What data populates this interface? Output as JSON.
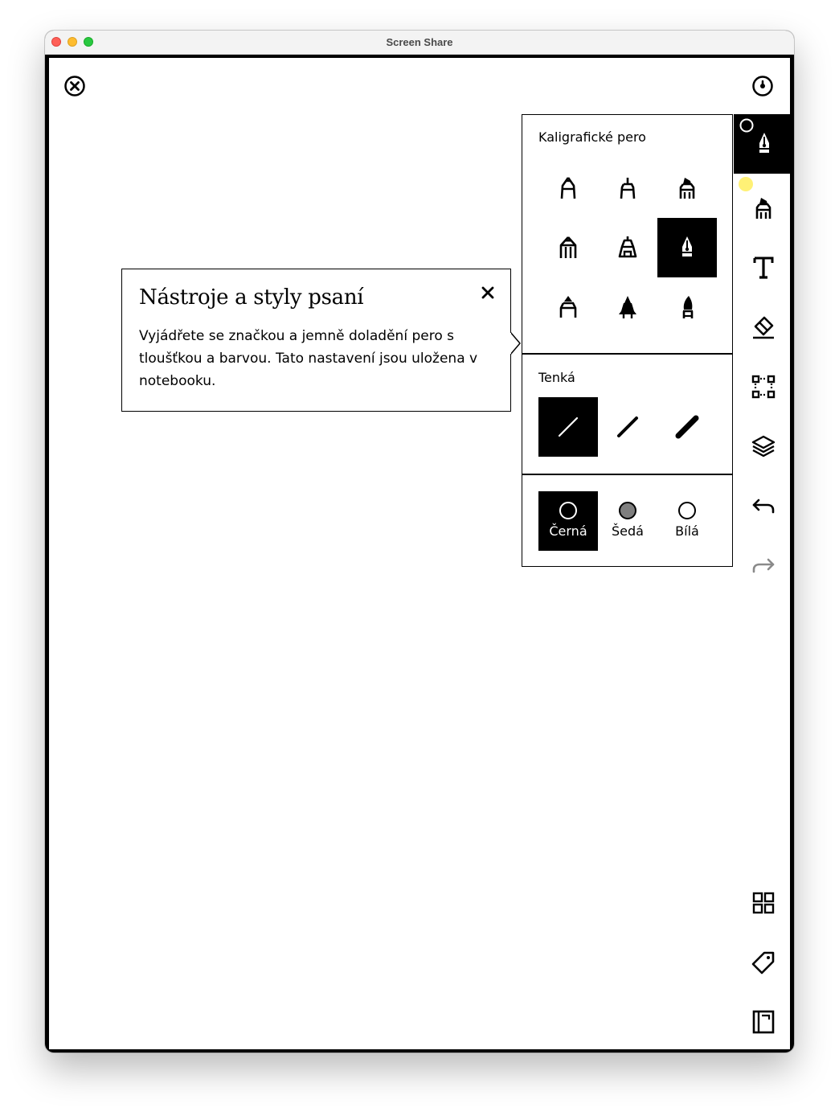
{
  "window": {
    "title": "Screen Share"
  },
  "top_bar": {
    "close_icon": "circle-x-icon",
    "sync_icon": "circle-dot-icon"
  },
  "pen_panel": {
    "title": "Kaligrafické pero",
    "pens": [
      {
        "icon": "ballpoint-pen-icon",
        "selected": false
      },
      {
        "icon": "fineliner-icon",
        "selected": false
      },
      {
        "icon": "marker-icon",
        "selected": false
      },
      {
        "icon": "pencil-icon",
        "selected": false
      },
      {
        "icon": "mechanical-pencil-icon",
        "selected": false
      },
      {
        "icon": "calligraphy-pen-icon",
        "selected": true
      },
      {
        "icon": "paintbrush-icon",
        "selected": false
      },
      {
        "icon": "highlighter-icon",
        "selected": false
      },
      {
        "icon": "brush-pen-icon",
        "selected": false
      }
    ],
    "thickness": {
      "label": "Tenká",
      "options": [
        {
          "icon": "thin-stroke-icon",
          "selected": true
        },
        {
          "icon": "medium-stroke-icon",
          "selected": false
        },
        {
          "icon": "thick-stroke-icon",
          "selected": false
        }
      ]
    },
    "colors": [
      {
        "label": "Černá",
        "fill": "#000000",
        "selected": true
      },
      {
        "label": "Šedá",
        "fill": "#7f7f7f",
        "selected": false
      },
      {
        "label": "Bílá",
        "fill": "#ffffff",
        "selected": false
      }
    ]
  },
  "toolbar": {
    "items": [
      {
        "icon": "calligraphy-pen-icon",
        "active": true
      },
      {
        "icon": "marker-icon",
        "active": false
      },
      {
        "icon": "text-icon",
        "active": false
      },
      {
        "icon": "eraser-icon",
        "active": false
      },
      {
        "icon": "selection-icon",
        "active": false
      },
      {
        "icon": "layers-icon",
        "active": false
      },
      {
        "icon": "undo-icon",
        "active": false
      },
      {
        "icon": "redo-icon",
        "active": false,
        "disabled": true
      }
    ],
    "bottom_items": [
      {
        "icon": "grid-icon"
      },
      {
        "icon": "tag-icon"
      },
      {
        "icon": "notebook-icon"
      }
    ]
  },
  "popup": {
    "title": "Nástroje a styly psaní",
    "body": "Vyjádřete se značkou a jemně doladění pero s tloušťkou a barvou. Tato nastavení jsou uložena v notebooku."
  },
  "colors": {
    "accent": "#000000",
    "cursor_highlight": "#fff176"
  }
}
